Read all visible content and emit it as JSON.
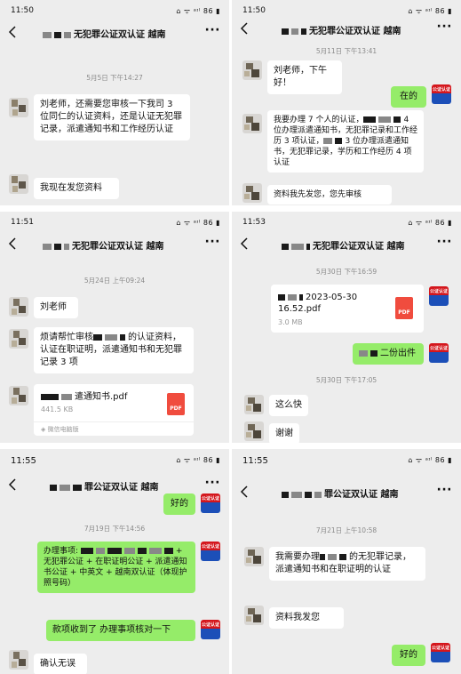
{
  "status": {
    "panel1_time": "11:50",
    "panel2_time": "11:50",
    "panel3_time": "11:51",
    "panel4_time": "11:53",
    "panel5_time": "11:55",
    "panel6_time": "11:55",
    "sys_icons": "⌂ ᯤ ᵃᶦˡ 86 ▮",
    "sys_icons_p3": "⌂ ᯤ ᵃᶦˡ 86 ▮",
    "sys_icons_p5": "⌂ ᯤ ᵃᶦˡ 86 ▮"
  },
  "nav": {
    "back_label": "<",
    "more_label": "···",
    "title_p1": "无犯罪公证双认证 越南",
    "title_p2": "无犯罪公证双认证 越南",
    "title_p3": "无犯罪公证双认证 越南",
    "title_p4": "无犯罪公证双认证 越南",
    "title_p5": "罪公证双认证 越南",
    "title_p6": "罪公证双认证 越南"
  },
  "me_avatar_label": "公证认证",
  "panel1": {
    "timestamp": "5月5日 下午14:27",
    "msg1": "刘老师，还需要您审核一下我司 3 位同仁的认证资料，还是认证无犯罪记录，派遣通知书和工作经历认证",
    "msg2": "我现在发您资料"
  },
  "panel2": {
    "timestamp": "5月11日 下午13:41",
    "msg1": "刘老师，下午好！",
    "msg2": "在的",
    "msg3_a": "我要办理 7 个人的认证，",
    "msg3_b": "4 位办理派遣通知书，无犯罪记录和工作经历 3 项认证，",
    "msg3_c": "3 位办理派遣通知书，无犯罪记录，学历和工作经历 4 项认证",
    "msg4": "资料我先发您，您先审核"
  },
  "panel3": {
    "timestamp": "5月24日 上午09:24",
    "msg1": "刘老师",
    "msg2_a": "烦请帮忙审核",
    "msg2_b": "的认证资料，认证在职证明，派遣通知书和无犯罪记录 3 项",
    "file_name": "遣通知书.pdf",
    "file_size": "441.5 KB",
    "file_source": "微信电脑版",
    "pdf_label": "PDF"
  },
  "panel4": {
    "timestamp1": "5月30日 下午16:59",
    "file_name": "2023-05-30 16.52.pdf",
    "file_size": "3.0 MB",
    "pdf_label": "PDF",
    "msg1": "二份出件",
    "timestamp2": "5月30日 下午17:05",
    "msg2": "这么快",
    "msg3": "谢谢"
  },
  "panel5": {
    "msg_top": "好的",
    "timestamp": "7月19日 下午14:56",
    "msg1_a": "办理事项:",
    "msg1_b": "+ 无犯罪公证 + 在职证明公证 + 派遣通知书公证 + 中英文 + 越南双认证（体现护照号码）",
    "msg2": "款项收到了  办理事项核对一下",
    "msg3": "确认无误"
  },
  "panel6": {
    "timestamp": "7月21日 上午10:58",
    "msg1_a": "我需要办理",
    "msg1_b": "的无犯罪记录，派遣通知书和在职证明的认证",
    "msg2": "资料我发您",
    "msg3": "好的"
  }
}
